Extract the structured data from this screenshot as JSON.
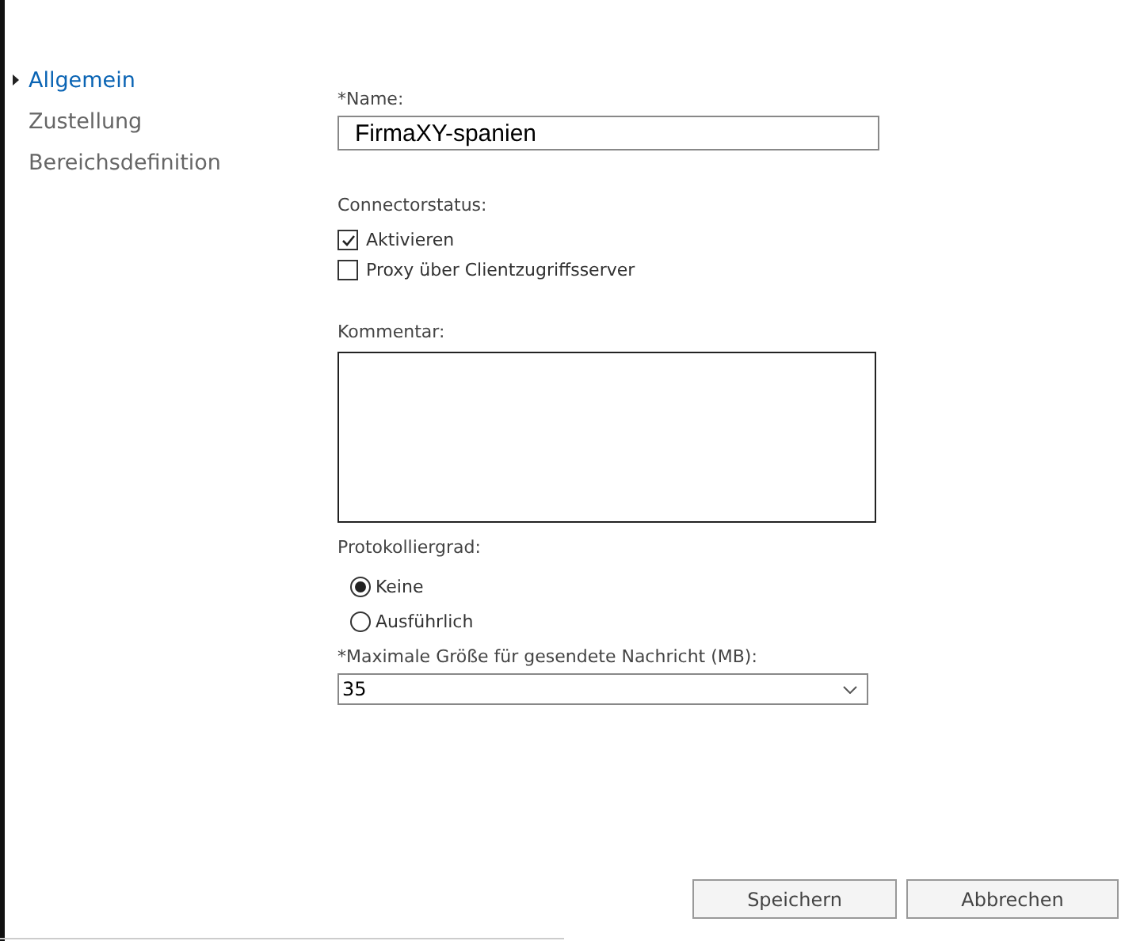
{
  "sidebar": {
    "items": [
      {
        "label": "Allgemein",
        "selected": true
      },
      {
        "label": "Zustellung",
        "selected": false
      },
      {
        "label": "Bereichsdefinition",
        "selected": false
      }
    ]
  },
  "form": {
    "name": {
      "label": "*Name:",
      "value": "FirmaXY-spanien"
    },
    "connector_status": {
      "label": "Connectorstatus:",
      "options": [
        {
          "label": "Aktivieren",
          "checked": true
        },
        {
          "label": "Proxy über Clientzugriffsserver",
          "checked": false
        }
      ]
    },
    "comment": {
      "label": "Kommentar:"
    },
    "logging_level": {
      "label": "Protokolliergrad:",
      "options": [
        {
          "label": "Keine",
          "selected": true
        },
        {
          "label": "Ausführlich",
          "selected": false
        }
      ]
    },
    "max_size": {
      "label": "*Maximale Größe für gesendete Nachricht (MB):",
      "value": "35"
    }
  },
  "buttons": [
    "Speichern",
    "Abbrechen"
  ]
}
